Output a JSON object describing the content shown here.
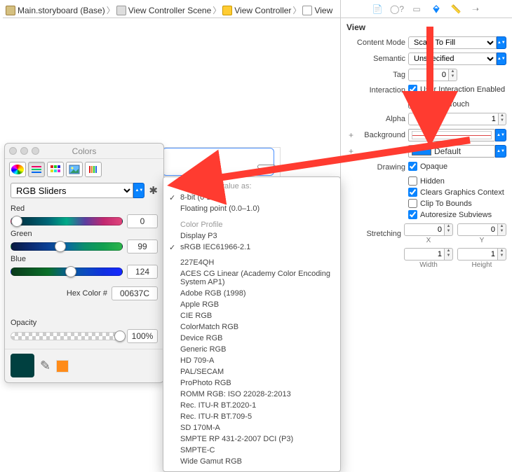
{
  "breadcrumb": {
    "seg0": "Main.storyboard (Base)",
    "seg1": "View Controller Scene",
    "seg2": "View Controller",
    "seg3": "View"
  },
  "inspector": {
    "title": "View",
    "contentMode": {
      "label": "Content Mode",
      "value": "Scale To Fill"
    },
    "semantic": {
      "label": "Semantic",
      "value": "Unspecified"
    },
    "tag": {
      "label": "Tag",
      "value": "0"
    },
    "interaction": {
      "label": "Interaction",
      "userInteraction": "User Interaction Enabled",
      "multipleTouch": "Multiple Touch"
    },
    "alpha": {
      "label": "Alpha",
      "value": "1"
    },
    "background": {
      "label": "Background"
    },
    "tint": {
      "label": "Tint",
      "value": "Default"
    },
    "drawing": {
      "label": "Drawing",
      "opaque": "Opaque",
      "hidden": "Hidden",
      "clears": "Clears Graphics Context",
      "clip": "Clip To Bounds",
      "autoresize": "Autoresize Subviews"
    },
    "stretching": {
      "label": "Stretching",
      "x": "0",
      "y": "0",
      "w": "1",
      "h": "1",
      "xlabel": "X",
      "ylabel": "Y",
      "wlabel": "Width",
      "hlabel": "Height"
    }
  },
  "colors": {
    "title": "Colors",
    "mode": "RGB Sliders",
    "red": {
      "label": "Red",
      "value": "0",
      "thumbPct": 0
    },
    "green": {
      "label": "Green",
      "value": "99",
      "thumbPct": 39
    },
    "blue": {
      "label": "Blue",
      "value": "124",
      "thumbPct": 49
    },
    "hex": {
      "label": "Hex Color #",
      "value": "00637C"
    },
    "opacity": {
      "label": "Opacity",
      "value": "100%",
      "thumbPct": 95
    }
  },
  "menu": {
    "header1": "Show color value as:",
    "items1": [
      "8-bit (0-255)",
      "Floating point (0.0–1.0)"
    ],
    "header2": "Color Profile",
    "items2": [
      "Display P3",
      "sRGB IEC61966-2.1"
    ],
    "items3": [
      "227E4QH",
      "ACES CG Linear (Academy Color Encoding System AP1)",
      "Adobe RGB (1998)",
      "Apple RGB",
      "CIE RGB",
      "ColorMatch RGB",
      "Device RGB",
      "Generic RGB",
      "HD 709-A",
      "PAL/SECAM",
      "ProPhoto RGB",
      "ROMM RGB: ISO 22028-2:2013",
      "Rec. ITU-R BT.2020-1",
      "Rec. ITU-R BT.709-5",
      "SD 170M-A",
      "SMPTE RP 431-2-2007 DCI (P3)",
      "SMPTE-C",
      "Wide Gamut RGB"
    ]
  }
}
